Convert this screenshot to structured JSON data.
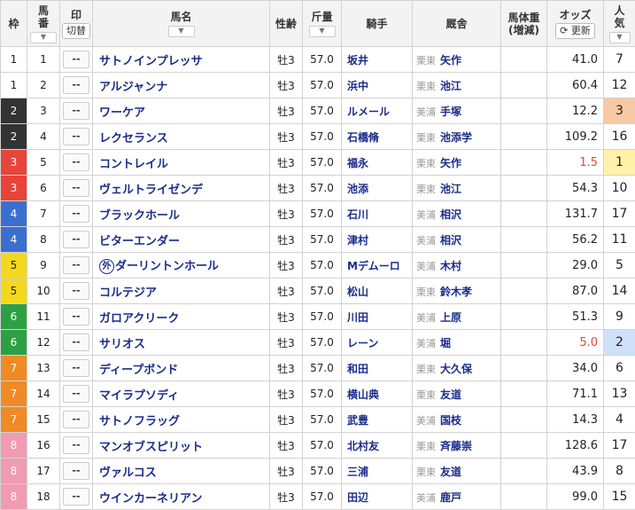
{
  "header": {
    "waku": "枠",
    "umaban_1": "馬",
    "umaban_2": "番",
    "mark": "印",
    "mark_toggle": "切替",
    "horse": "馬名",
    "sexage": "性齢",
    "weight": "斤量",
    "jockey": "騎手",
    "stable": "厩舎",
    "body_1": "馬体重",
    "body_2": "(増減)",
    "odds": "オッズ",
    "refresh": "更新",
    "popularity_1": "人",
    "popularity_2": "気",
    "sort_icon": "chevron-down-icon",
    "refresh_icon": "refresh-icon"
  },
  "colors": {
    "waku": {
      "1": {
        "bg": "#ffffff",
        "fg": "#222222"
      },
      "2": {
        "bg": "#333333",
        "fg": "#ffffff"
      },
      "3": {
        "bg": "#e8443a",
        "fg": "#ffffff"
      },
      "4": {
        "bg": "#3a6fd0",
        "fg": "#ffffff"
      },
      "5": {
        "bg": "#f4d81e",
        "fg": "#222222"
      },
      "6": {
        "bg": "#2ea043",
        "fg": "#ffffff"
      },
      "7": {
        "bg": "#f08a24",
        "fg": "#ffffff"
      },
      "8": {
        "bg": "#f19bb2",
        "fg": "#ffffff"
      }
    }
  },
  "rows": [
    {
      "waku": "1",
      "num": "1",
      "mark": "--",
      "name": "サトノインプレッサ",
      "foreign": "",
      "sexage": "牡3",
      "weight": "57.0",
      "jockey": "坂井",
      "region": "栗東",
      "trainer": "矢作",
      "body": "",
      "odds": "41.0",
      "pop": "7"
    },
    {
      "waku": "1",
      "num": "2",
      "mark": "--",
      "name": "アルジャンナ",
      "foreign": "",
      "sexage": "牡3",
      "weight": "57.0",
      "jockey": "浜中",
      "region": "栗東",
      "trainer": "池江",
      "body": "",
      "odds": "60.4",
      "pop": "12"
    },
    {
      "waku": "2",
      "num": "3",
      "mark": "--",
      "name": "ワーケア",
      "foreign": "",
      "sexage": "牡3",
      "weight": "57.0",
      "jockey": "ルメール",
      "region": "美浦",
      "trainer": "手塚",
      "body": "",
      "odds": "12.2",
      "pop": "3"
    },
    {
      "waku": "2",
      "num": "4",
      "mark": "--",
      "name": "レクセランス",
      "foreign": "",
      "sexage": "牡3",
      "weight": "57.0",
      "jockey": "石橋脩",
      "region": "栗東",
      "trainer": "池添学",
      "body": "",
      "odds": "109.2",
      "pop": "16"
    },
    {
      "waku": "3",
      "num": "5",
      "mark": "--",
      "name": "コントレイル",
      "foreign": "",
      "sexage": "牡3",
      "weight": "57.0",
      "jockey": "福永",
      "region": "栗東",
      "trainer": "矢作",
      "body": "",
      "odds": "1.5",
      "pop": "1"
    },
    {
      "waku": "3",
      "num": "6",
      "mark": "--",
      "name": "ヴェルトライゼンデ",
      "foreign": "",
      "sexage": "牡3",
      "weight": "57.0",
      "jockey": "池添",
      "region": "栗東",
      "trainer": "池江",
      "body": "",
      "odds": "54.3",
      "pop": "10"
    },
    {
      "waku": "4",
      "num": "7",
      "mark": "--",
      "name": "ブラックホール",
      "foreign": "",
      "sexage": "牡3",
      "weight": "57.0",
      "jockey": "石川",
      "region": "美浦",
      "trainer": "相沢",
      "body": "",
      "odds": "131.7",
      "pop": "17"
    },
    {
      "waku": "4",
      "num": "8",
      "mark": "--",
      "name": "ビターエンダー",
      "foreign": "",
      "sexage": "牡3",
      "weight": "57.0",
      "jockey": "津村",
      "region": "美浦",
      "trainer": "相沢",
      "body": "",
      "odds": "56.2",
      "pop": "11"
    },
    {
      "waku": "5",
      "num": "9",
      "mark": "--",
      "name": "ダーリントンホール",
      "foreign": "外",
      "sexage": "牡3",
      "weight": "57.0",
      "jockey": "Mデムーロ",
      "region": "美浦",
      "trainer": "木村",
      "body": "",
      "odds": "29.0",
      "pop": "5"
    },
    {
      "waku": "5",
      "num": "10",
      "mark": "--",
      "name": "コルテジア",
      "foreign": "",
      "sexage": "牡3",
      "weight": "57.0",
      "jockey": "松山",
      "region": "栗東",
      "trainer": "鈴木孝",
      "body": "",
      "odds": "87.0",
      "pop": "14"
    },
    {
      "waku": "6",
      "num": "11",
      "mark": "--",
      "name": "ガロアクリーク",
      "foreign": "",
      "sexage": "牡3",
      "weight": "57.0",
      "jockey": "川田",
      "region": "美浦",
      "trainer": "上原",
      "body": "",
      "odds": "51.3",
      "pop": "9"
    },
    {
      "waku": "6",
      "num": "12",
      "mark": "--",
      "name": "サリオス",
      "foreign": "",
      "sexage": "牡3",
      "weight": "57.0",
      "jockey": "レーン",
      "region": "美浦",
      "trainer": "堀",
      "body": "",
      "odds": "5.0",
      "pop": "2"
    },
    {
      "waku": "7",
      "num": "13",
      "mark": "--",
      "name": "ディープボンド",
      "foreign": "",
      "sexage": "牡3",
      "weight": "57.0",
      "jockey": "和田",
      "region": "栗東",
      "trainer": "大久保",
      "body": "",
      "odds": "34.0",
      "pop": "6"
    },
    {
      "waku": "7",
      "num": "14",
      "mark": "--",
      "name": "マイラプソディ",
      "foreign": "",
      "sexage": "牡3",
      "weight": "57.0",
      "jockey": "横山典",
      "region": "栗東",
      "trainer": "友道",
      "body": "",
      "odds": "71.1",
      "pop": "13"
    },
    {
      "waku": "7",
      "num": "15",
      "mark": "--",
      "name": "サトノフラッグ",
      "foreign": "",
      "sexage": "牡3",
      "weight": "57.0",
      "jockey": "武豊",
      "region": "美浦",
      "trainer": "国枝",
      "body": "",
      "odds": "14.3",
      "pop": "4"
    },
    {
      "waku": "8",
      "num": "16",
      "mark": "--",
      "name": "マンオブスピリット",
      "foreign": "",
      "sexage": "牡3",
      "weight": "57.0",
      "jockey": "北村友",
      "region": "栗東",
      "trainer": "斉藤崇",
      "body": "",
      "odds": "128.6",
      "pop": "17"
    },
    {
      "waku": "8",
      "num": "17",
      "mark": "--",
      "name": "ヴァルコス",
      "foreign": "",
      "sexage": "牡3",
      "weight": "57.0",
      "jockey": "三浦",
      "region": "栗東",
      "trainer": "友道",
      "body": "",
      "odds": "43.9",
      "pop": "8"
    },
    {
      "waku": "8",
      "num": "18",
      "mark": "--",
      "name": "ウインカーネリアン",
      "foreign": "",
      "sexage": "牡3",
      "weight": "57.0",
      "jockey": "田辺",
      "region": "美浦",
      "trainer": "鹿戸",
      "body": "",
      "odds": "99.0",
      "pop": "15"
    }
  ]
}
